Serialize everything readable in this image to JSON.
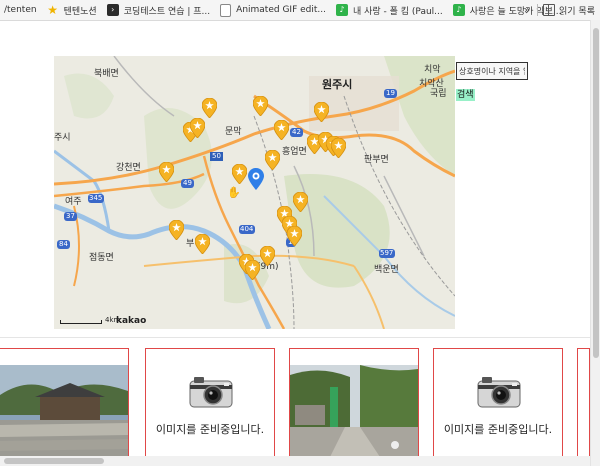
{
  "bookmarks": [
    {
      "label": "/tenten",
      "icon": "none"
    },
    {
      "label": "텐텐노션",
      "icon": "star-icon"
    },
    {
      "label": "코딩테스트 연습 | 프...",
      "icon": "programmers-icon"
    },
    {
      "label": "Animated GIF edit...",
      "icon": "file-icon"
    },
    {
      "label": "내 사랑 - 폴 킴 (Paul...",
      "icon": "melon-icon"
    },
    {
      "label": "사랑은 늘 도망가 악보...",
      "icon": "melon-icon"
    }
  ],
  "bookmarks_more": "»",
  "reading_list": "읽기 목록",
  "map": {
    "labels": {
      "bukbae": "북배면",
      "wonju": "원주시",
      "chiaksan": "치악산",
      "chiak2": "치악",
      "guknip": "국립",
      "jusi": "주시",
      "munmak": "문막",
      "gangcheon": "강천면",
      "heungeop": "흥업면",
      "panbu": "판부면",
      "yeoju": "여주",
      "jeongdong": "점동면",
      "bu": "부",
      "sinrim": "(9m)",
      "baekun": "백운면"
    },
    "roads": {
      "r42": "42",
      "r50": "50",
      "r49": "49",
      "r345": "345",
      "r37": "37",
      "r84": "84",
      "r404": "404",
      "r597": "597",
      "r19": "19",
      "r1": "1"
    },
    "scale_text": "4km",
    "logo": "kakao",
    "colors": {
      "marker": "#f5b324",
      "current": "#2f7fe8"
    }
  },
  "search": {
    "placeholder": "상호명이나 지역을 입력",
    "button": "검색"
  },
  "cards": [
    {
      "type": "photo",
      "text": ""
    },
    {
      "type": "noimage",
      "text": "이미지를 준비중입니다."
    },
    {
      "type": "photo",
      "text": ""
    },
    {
      "type": "noimage",
      "text": "이미지를 준비중입니다."
    }
  ]
}
